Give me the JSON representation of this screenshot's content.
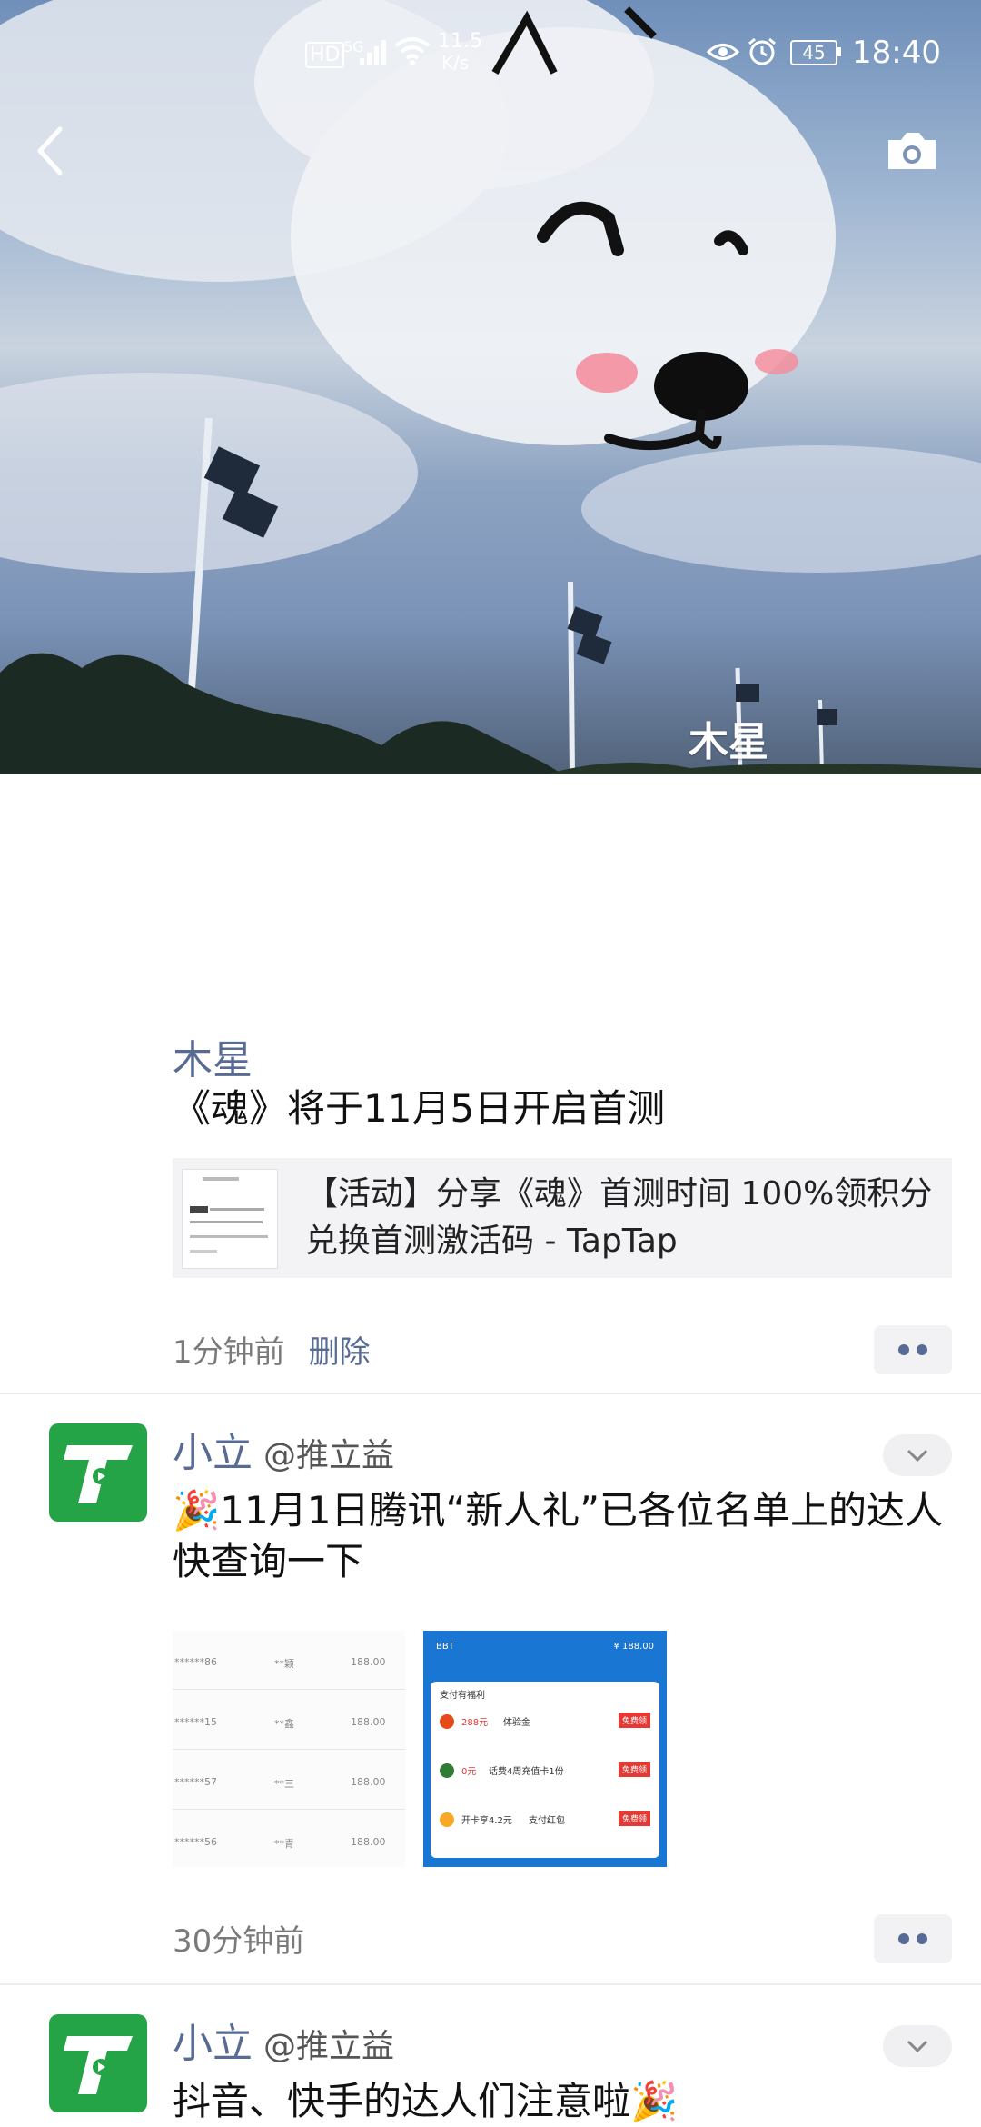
{
  "status_bar": {
    "hd": "HD",
    "network": "5G",
    "speed_value": "11.5",
    "speed_unit": "K/s",
    "battery": "45",
    "time": "18:40"
  },
  "cover": {
    "owner_name": "木星"
  },
  "posts": [
    {
      "author": "木星",
      "text": "《魂》将于11月5日开启首测",
      "link_title": "【活动】分享《魂》首测时间 100%领积分兑换首测激活码 - TapTap",
      "time": "1分钟前",
      "delete_label": "删除"
    },
    {
      "author": "小立",
      "handle": "@推立益",
      "text": "🎉11月1日腾讯“新人礼”已各位名单上的达人快查询一下",
      "time": "30分钟前",
      "image_rows": [
        {
          "id": "******86",
          "name": "**颖",
          "amount": "188.00"
        },
        {
          "id": "******15",
          "name": "**鑫",
          "amount": "188.00"
        },
        {
          "id": "******57",
          "name": "**三",
          "amount": "188.00"
        },
        {
          "id": "******56",
          "name": "**青",
          "amount": "188.00"
        }
      ],
      "image_phone": {
        "header_left": "BBT",
        "header_right": "¥ 188.00",
        "title": "支付有福利",
        "items": [
          {
            "amount": "288元",
            "text": "体验金",
            "btn": "免费领"
          },
          {
            "amount": "0元",
            "text": "话费4周充值卡1份",
            "btn": "免费领"
          },
          {
            "amount": "开卡享4.2元",
            "text": "支付红包",
            "btn": "免费领"
          }
        ]
      }
    },
    {
      "author": "小立",
      "handle": "@推立益",
      "text": "抖音、快手的达人们注意啦🎉"
    }
  ]
}
